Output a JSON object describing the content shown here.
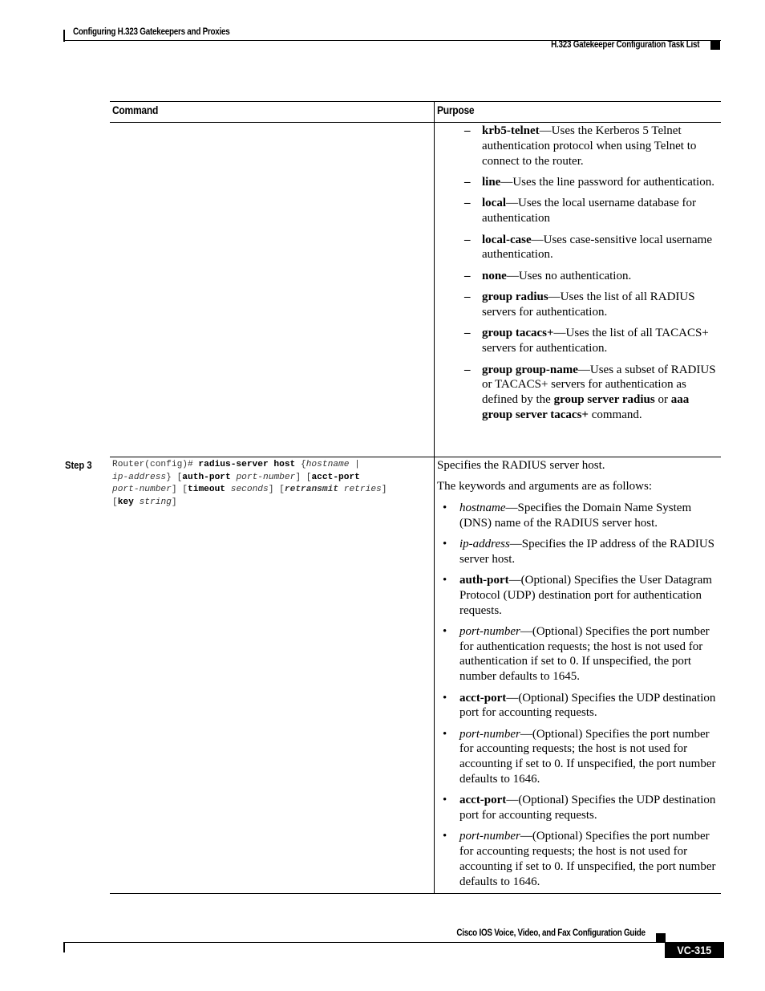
{
  "header": {
    "chapter_title": "Configuring H.323 Gatekeepers and Proxies",
    "section_title": "H.323 Gatekeeper Configuration Task List"
  },
  "table": {
    "columns": {
      "command": "Command",
      "purpose": "Purpose"
    },
    "continued_row": {
      "items": [
        {
          "keyword": "krb5-telnet",
          "text": "—Uses the Kerberos 5 Telnet authentication protocol when using Telnet to connect to the router."
        },
        {
          "keyword": "line",
          "text": "—Uses the line password for authentication."
        },
        {
          "keyword": "local",
          "text": "—Uses the local username database for authentication"
        },
        {
          "keyword": "local-case",
          "text": "—Uses case-sensitive local username authentication."
        },
        {
          "keyword": "none",
          "text": "—Uses no authentication."
        },
        {
          "keyword": "group radius",
          "text": "—Uses the list of all RADIUS servers for authentication."
        },
        {
          "keyword": "group tacacs+",
          "text": "—Uses the list of all TACACS+ servers for authentication."
        },
        {
          "keyword": "group group-name",
          "text": "—Uses a subset of RADIUS or TACACS+ servers for authentication as defined by the ",
          "bold2": "group server radius",
          "mid": " or ",
          "bold3": "aaa group server tacacs+",
          "tail": " command."
        }
      ]
    },
    "step3": {
      "label": "Step 3",
      "command": {
        "prompt": "Router(config)# ",
        "keyword": "radius-server host",
        "p1": " {",
        "arg_hostname": "hostname",
        "p2": " |",
        "arg_ip": "ip-address",
        "p3": "} [",
        "kw_auth": "auth-port",
        "arg_port1": "port-number",
        "p4": "] [",
        "kw_acct": "acct-port",
        "arg_port2": "port-number",
        "p5": "] [",
        "kw_timeout": "timeout",
        "arg_seconds": "seconds",
        "p6": "] [",
        "kw_retransmit": "retransmit",
        "arg_retries": "retries",
        "p7": "]",
        "p8": "[",
        "kw_key": "key",
        "arg_string": "string",
        "p9": "]"
      },
      "purpose_intro": "Specifies the RADIUS server host.",
      "purpose_lead": "The keywords and arguments are as follows:",
      "bullets": [
        {
          "term": "hostname",
          "style": "italic",
          "text": "—Specifies the Domain Name System (DNS) name of the RADIUS server host."
        },
        {
          "term": "ip-address",
          "style": "italic",
          "text": "—Specifies the IP address of the RADIUS server host."
        },
        {
          "term": "auth-port",
          "style": "bold",
          "text": "—(Optional) Specifies the User Datagram Protocol (UDP) destination port for authentication requests."
        },
        {
          "term": "port-number",
          "style": "italic",
          "text": "—(Optional) Specifies the port number for authentication requests; the host is not used for authentication if set to 0. If unspecified, the port number defaults to 1645."
        },
        {
          "term": "acct-port",
          "style": "bold",
          "text": "—(Optional) Specifies the UDP destination port for accounting requests."
        },
        {
          "term": "port-number",
          "style": "italic",
          "text": "—(Optional) Specifies the port number for accounting requests; the host is not used for accounting if set to 0. If unspecified, the port number defaults to 1646."
        },
        {
          "term": "acct-port",
          "style": "bold",
          "text": "—(Optional) Specifies the UDP destination port for accounting requests."
        },
        {
          "term": "port-number",
          "style": "italic",
          "text": "—(Optional) Specifies the port number for accounting requests; the host is not used for accounting if set to 0. If unspecified, the port number defaults to 1646."
        }
      ]
    }
  },
  "footer": {
    "guide_title": "Cisco IOS Voice, Video, and Fax Configuration Guide",
    "page_number": "VC-315"
  },
  "glyphs": {
    "dash": "–",
    "bullet": "•"
  }
}
